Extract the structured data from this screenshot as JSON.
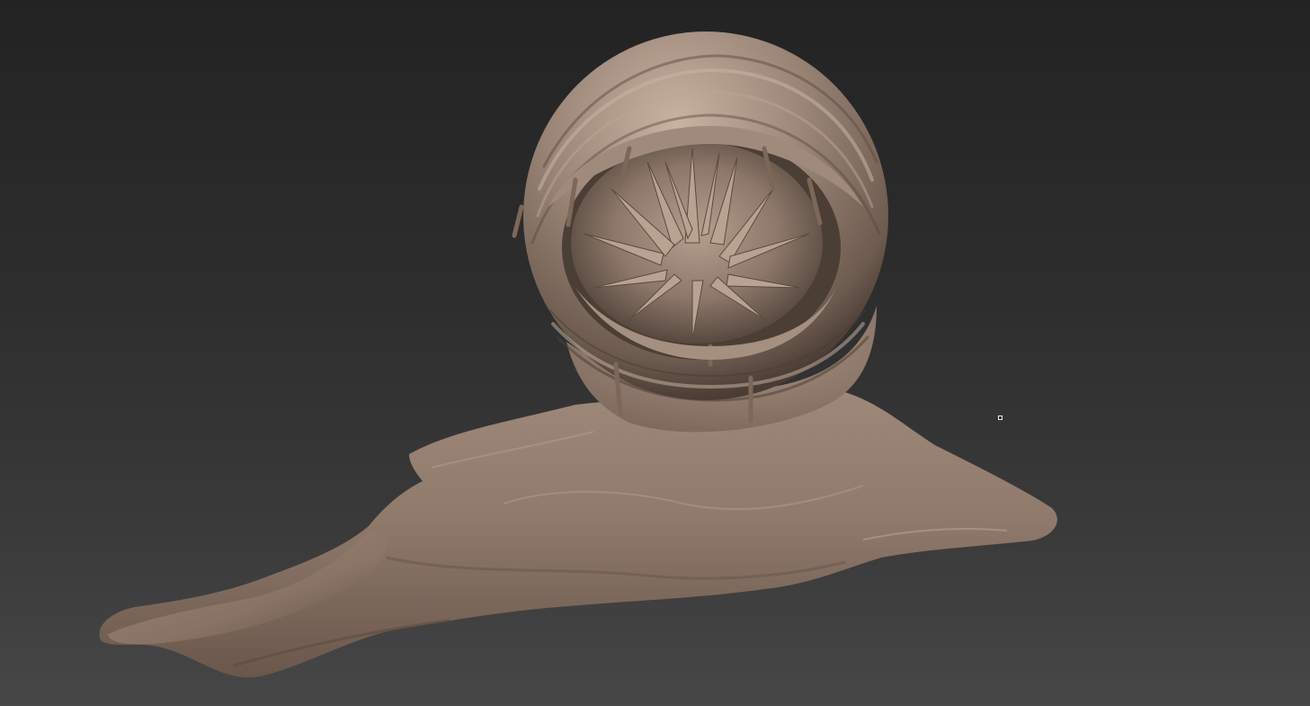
{
  "viewport": {
    "background_top": "#232323",
    "background_bottom": "#474747"
  },
  "model": {
    "material_base": "#8f7a6c",
    "material_highlight": "#c4ae9e",
    "material_shadow": "#4a3c34"
  },
  "cursor": {
    "icon": "square-brush-cursor-icon"
  }
}
